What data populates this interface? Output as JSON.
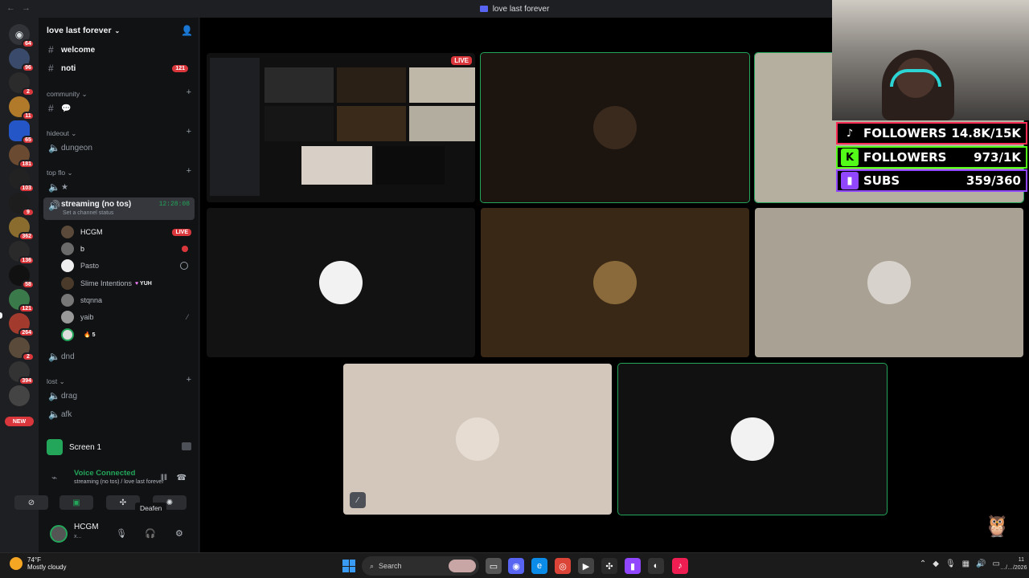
{
  "window": {
    "title": "love last forever"
  },
  "rail": {
    "servers": [
      {
        "badge": "64"
      },
      {
        "badge": "96"
      },
      {
        "badge": "2"
      },
      {
        "badge": "11"
      },
      {
        "badge": "65"
      },
      {
        "badge": "181"
      },
      {
        "badge": "103"
      },
      {
        "badge": "9"
      },
      {
        "badge": "362"
      },
      {
        "badge": "136"
      },
      {
        "badge": "58"
      },
      {
        "badge": "121"
      },
      {
        "badge": "264"
      },
      {
        "badge": "2"
      },
      {
        "badge": "394"
      }
    ],
    "new_label": "NEW"
  },
  "sidebar": {
    "server_name": "love last forever",
    "channels": {
      "welcome": "welcome",
      "noti": "noti",
      "noti_count": "121",
      "cat_community": "community",
      "chat": "💬",
      "cat_hideout": "hideout",
      "dungeon": "dungeon",
      "cat_topflo": "top flo",
      "star": "★",
      "streaming": "streaming (no tos)",
      "streaming_timer": "12:28:08",
      "streaming_status": "Set a channel status",
      "dnd": "dnd",
      "cat_lost": "lost",
      "drag": "drag",
      "afk": "afk"
    },
    "members": [
      {
        "name": "HCGM",
        "live": "LIVE"
      },
      {
        "name": "b"
      },
      {
        "name": "Pasto"
      },
      {
        "name": "Slime Intentions",
        "tag": "YUH",
        "tag_icon": "♥"
      },
      {
        "name": "stqnna"
      },
      {
        "name": "yaib"
      },
      {
        "name": "",
        "tag": "5",
        "tag_icon": "🔥"
      }
    ]
  },
  "panel": {
    "screen_title": "Screen 1",
    "voice_status": "Voice Connected",
    "voice_location": "streaming (no tos) / love last forever",
    "tooltip": "Deafen",
    "user_name": "HCGM",
    "user_sub": "x..."
  },
  "stage": {
    "live_badge": "LIVE"
  },
  "overlay": {
    "tiktok": {
      "label": "FOLLOWERS",
      "value": "14.8K/15K"
    },
    "kick": {
      "label": "FOLLOWERS",
      "value": "973/1K"
    },
    "twitch": {
      "label": "SUBS",
      "value": "359/360"
    }
  },
  "taskbar": {
    "weather_temp": "74°F",
    "weather_desc": "Mostly cloudy",
    "search_label": "Search",
    "clock_time": "11",
    "clock_date": "…/…/2026"
  }
}
